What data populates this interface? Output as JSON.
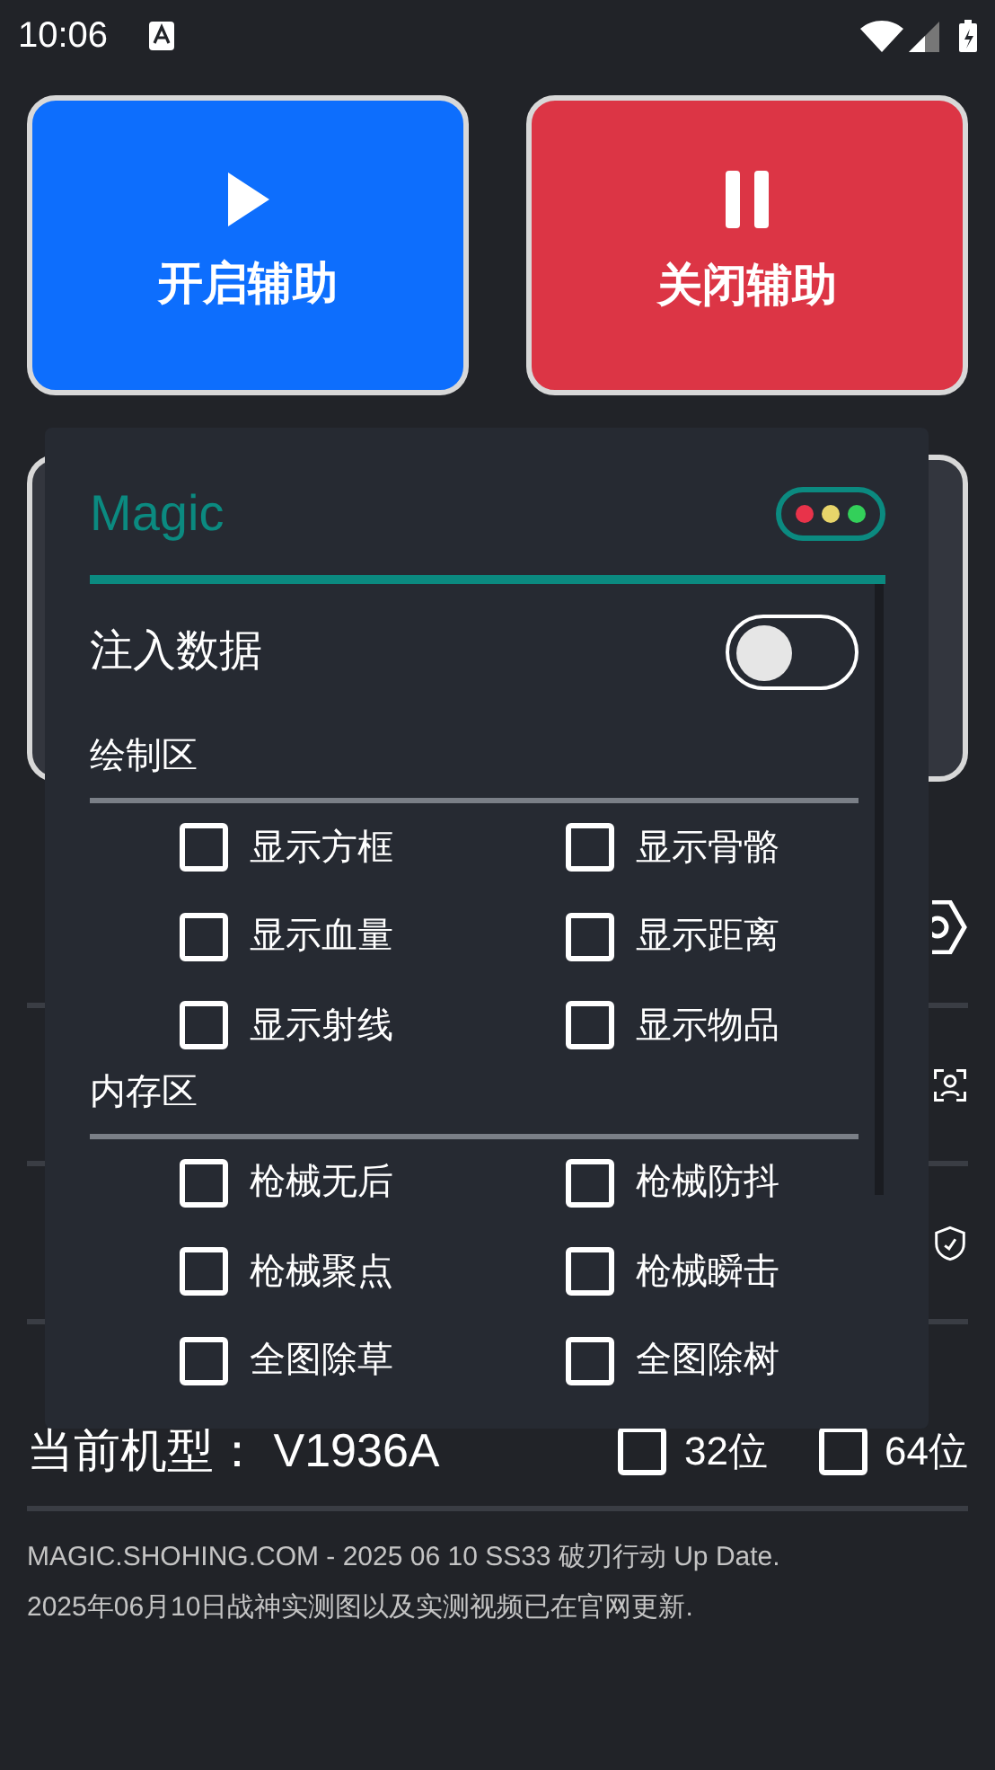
{
  "status_bar": {
    "time": "10:06"
  },
  "buttons": [
    {
      "label": "开启辅助",
      "kind": "start"
    },
    {
      "label": "关闭辅助",
      "kind": "stop"
    }
  ],
  "menu_rows": [
    {
      "kind": "settings"
    },
    {
      "kind": "scan"
    },
    {
      "kind": "shield"
    }
  ],
  "device": {
    "label": "当前机型： V1936A",
    "options": [
      {
        "label": "32位",
        "checked": false
      },
      {
        "label": "64位",
        "checked": false
      }
    ]
  },
  "footer": [
    "MAGIC.SHOHING.COM - 2025 06 10 SS33 破刃行动 Up Date.",
    "2025年06月10日战神实测图以及实测视频已在官网更新."
  ],
  "panel": {
    "title": "Magic",
    "inject": {
      "label": "注入数据",
      "on": false
    },
    "sections": [
      {
        "title": "绘制区",
        "options": [
          {
            "label": "显示方框",
            "checked": false
          },
          {
            "label": "显示骨骼",
            "checked": false
          },
          {
            "label": "显示血量",
            "checked": false
          },
          {
            "label": "显示距离",
            "checked": false
          },
          {
            "label": "显示射线",
            "checked": false
          },
          {
            "label": "显示物品",
            "checked": false
          }
        ]
      },
      {
        "title": "内存区",
        "options": [
          {
            "label": "枪械无后",
            "checked": false
          },
          {
            "label": "枪械防抖",
            "checked": false
          },
          {
            "label": "枪械聚点",
            "checked": false
          },
          {
            "label": "枪械瞬击",
            "checked": false
          },
          {
            "label": "全图除草",
            "checked": false
          },
          {
            "label": "全图除树",
            "checked": false
          }
        ]
      }
    ]
  }
}
